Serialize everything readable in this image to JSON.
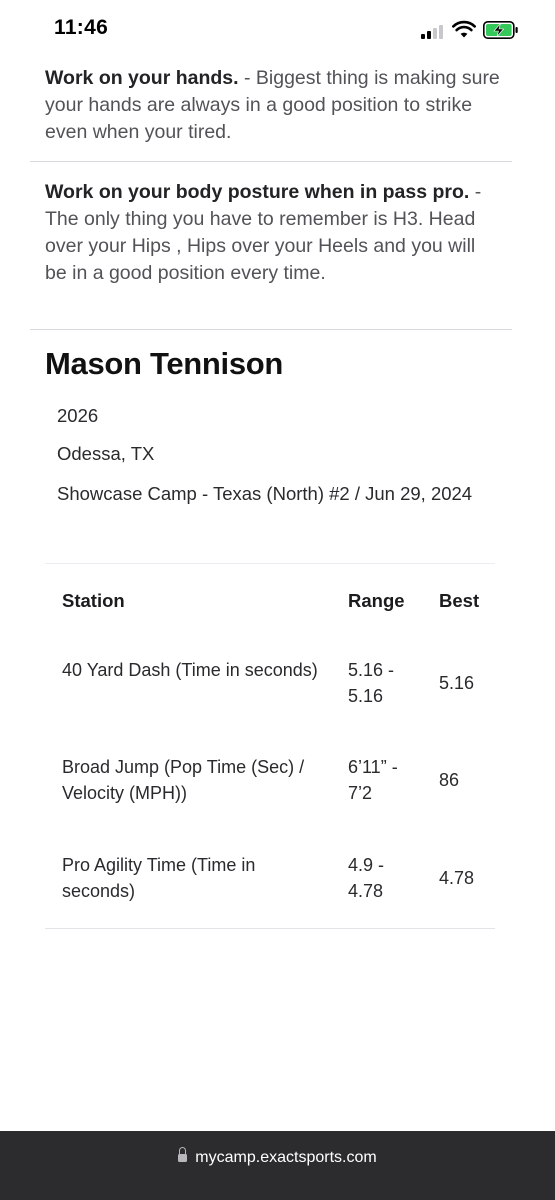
{
  "status_bar": {
    "time": "11:46",
    "icons": [
      "cellular-signal-icon",
      "wifi-icon",
      "battery-charging-icon"
    ],
    "battery_color": "#34c759"
  },
  "tips": [
    {
      "title": "Work on your hands.",
      "body": " - Biggest thing is making sure your hands are always in a good position to strike even when your tired."
    },
    {
      "title": "Work on your body posture when in pass pro.",
      "body": " - The only thing you have to remember is H3. Head over your Hips , Hips over your Heels and you will be in a good position every time."
    }
  ],
  "athlete": {
    "name": "Mason Tennison",
    "class_year": "2026",
    "location": "Odessa, TX",
    "event": "Showcase Camp - Texas (North) #2 / Jun 29, 2024"
  },
  "results": {
    "headers": {
      "station": "Station",
      "range": "Range",
      "best": "Best"
    },
    "rows": [
      {
        "station": "40 Yard Dash (Time in seconds)",
        "range": "5.16 - 5.16",
        "best": "5.16"
      },
      {
        "station": "Broad Jump (Pop Time (Sec) / Velocity (MPH))",
        "range": "6’11” - 7’2",
        "best": "86"
      },
      {
        "station": "Pro Agility Time (Time in seconds)",
        "range": "4.9 - 4.78",
        "best": "4.78"
      }
    ]
  },
  "browser": {
    "url": "mycamp.exactsports.com"
  }
}
